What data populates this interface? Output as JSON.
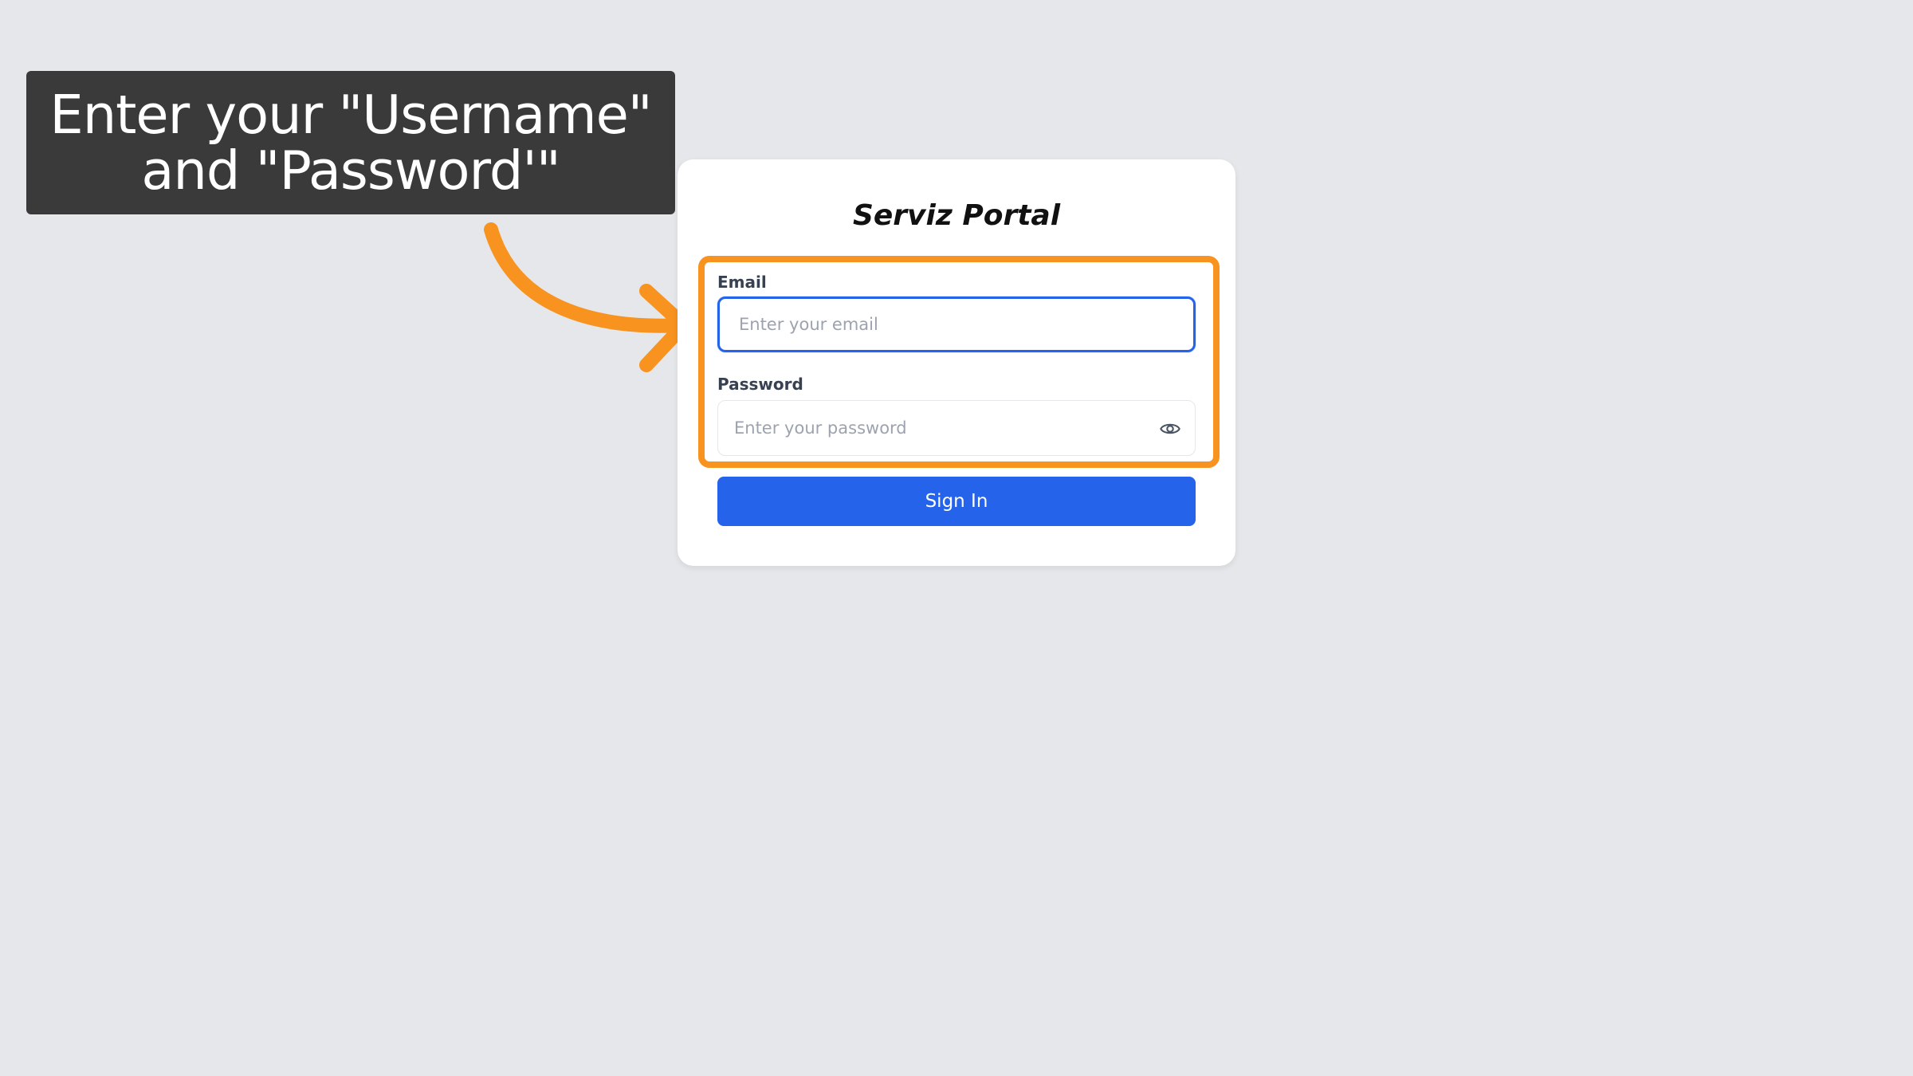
{
  "callout": {
    "line1": "Enter your \"Username\"",
    "line2": "and \"Password'\""
  },
  "login": {
    "title": "Serviz Portal",
    "email_label": "Email",
    "email_placeholder": "Enter your email",
    "email_value": "",
    "password_label": "Password",
    "password_placeholder": "Enter your password",
    "password_value": "",
    "signin_label": "Sign In"
  },
  "icons": {
    "password_toggle": "eye-icon"
  },
  "colors": {
    "background": "#e5e7eb",
    "callout_background": "#3a3a3a",
    "highlight": "#f7931e",
    "primary": "#2563eb"
  }
}
